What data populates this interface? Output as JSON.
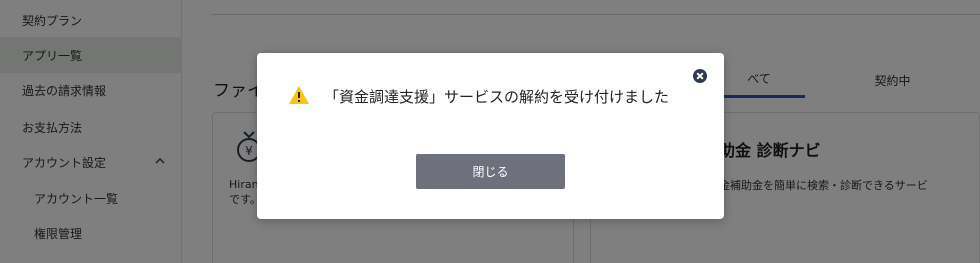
{
  "sidebar": {
    "items": [
      {
        "label": "契約プラン"
      },
      {
        "label": "アプリ一覧"
      },
      {
        "label": "過去の請求情報"
      },
      {
        "label": "お支払方法"
      },
      {
        "label": "アカウント設定"
      },
      {
        "label": "アカウント一覧"
      },
      {
        "label": "権限管理"
      }
    ],
    "active_index": 1
  },
  "main": {
    "section_title": "ファイ",
    "tabs": [
      {
        "label": "べて"
      },
      {
        "label": "契約中"
      }
    ],
    "cards": [
      {
        "desc_line1": "Hiran",
        "desc_line2": "です。",
        "icon": "money-bag-yen-icon"
      },
      {
        "title": "助金 診断ナビ",
        "desc": "金補助金を簡単に検索・診断できるサービ"
      }
    ]
  },
  "modal": {
    "message": "「資金調達支援」サービスの解約を受け付けました",
    "button_label": "閉じる",
    "icon": "warning-icon"
  },
  "colors": {
    "overlay": "rgba(0,0,0,0.5)",
    "button": "#6e707c",
    "warning": "#f5c518",
    "tab_underline": "#2c57b0",
    "close": "#2f3a4e"
  }
}
